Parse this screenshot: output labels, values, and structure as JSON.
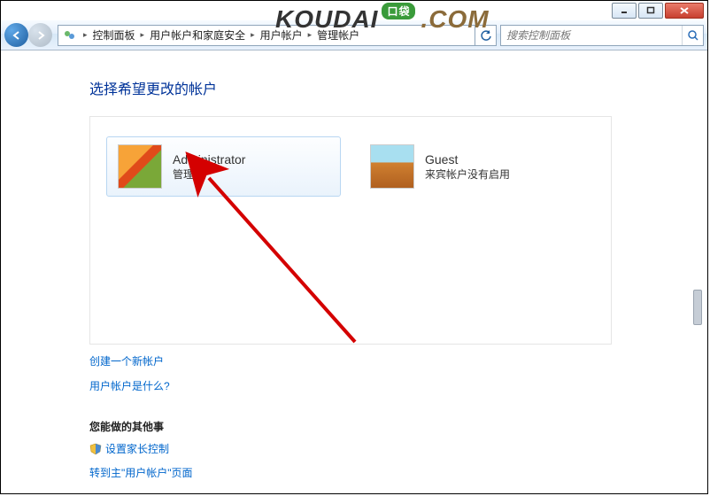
{
  "watermark": {
    "text": "KOUDAI",
    "badge": "口袋",
    "suffix": ".COM"
  },
  "window_controls": {
    "minimize": "minimize",
    "maximize": "maximize",
    "close": "close"
  },
  "breadcrumb": {
    "items": [
      "控制面板",
      "用户帐户和家庭安全",
      "用户帐户",
      "管理帐户"
    ]
  },
  "search": {
    "placeholder": "搜索控制面板"
  },
  "main": {
    "heading": "选择希望更改的帐户",
    "accounts": [
      {
        "name": "Administrator",
        "desc": "管理员",
        "selected": true,
        "picture": "flower"
      },
      {
        "name": "Guest",
        "desc": "来宾帐户没有启用",
        "selected": false,
        "picture": "suitcase"
      }
    ],
    "link_create": "创建一个新帐户",
    "link_whatis": "用户帐户是什么?",
    "other_heading": "您能做的其他事",
    "link_parental": "设置家长控制",
    "link_goto_main": "转到主\"用户帐户\"页面"
  }
}
